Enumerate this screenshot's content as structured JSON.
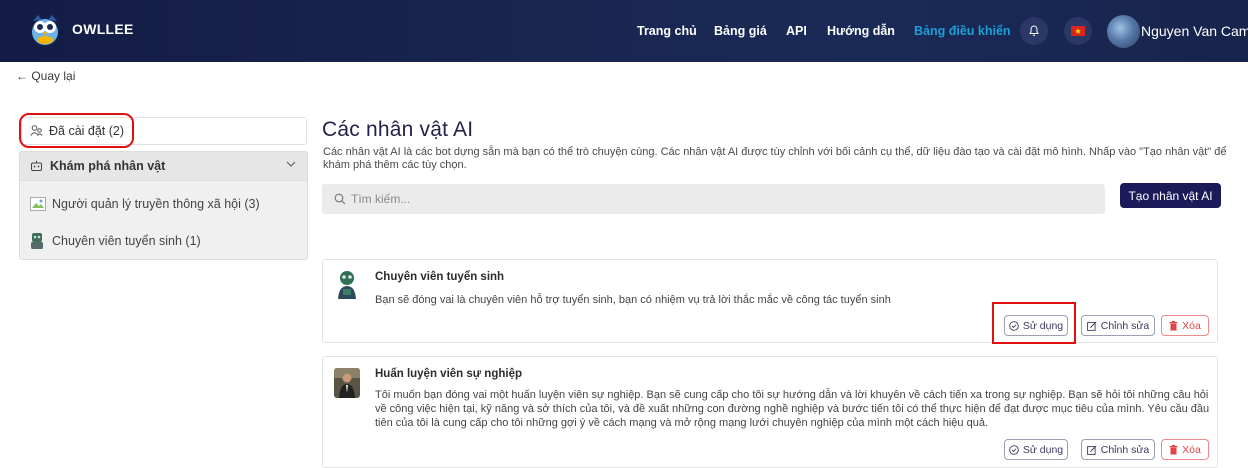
{
  "brand": {
    "name": "OWLLEE"
  },
  "nav": {
    "home": "Trang chủ",
    "pricing": "Bảng giá",
    "api": "API",
    "guide": "Hướng dẫn",
    "dashboard": "Bảng điều khiển",
    "user_name": "Nguyen Van Cam"
  },
  "back_link": "← Quay lại",
  "sidebar": {
    "installed_label": "Đã cài đặt (2)",
    "explore_header": "Khám phá nhân vật",
    "items": [
      {
        "label": "Người quản lý truyền thông xã hội (3)",
        "icon": "broken-image-icon"
      },
      {
        "label": "Chuyên viên tuyển sinh (1)",
        "icon": "robot-avatar-icon"
      }
    ]
  },
  "main": {
    "title": "Các nhân vật AI",
    "description": "Các nhân vật AI là các bot dựng sẵn mà bạn có thể trò chuyện cùng. Các nhân vật AI được tùy chỉnh với bối cảnh cụ thể, dữ liệu đào tạo và cài đặt mô hình. Nhấp vào \"Tạo nhân vật\" để khám phá thêm các tùy chọn.",
    "search_placeholder": "Tìm kiếm...",
    "create_button": "Tạo nhân vật AI"
  },
  "cards": [
    {
      "title": "Chuyên viên tuyển sinh",
      "description": "Bạn sẽ đóng vai là chuyên viên hỗ trợ tuyển sinh, bạn có nhiệm vụ trả lời thắc mắc về công tác tuyển sinh",
      "use_label": "Sử dụng",
      "edit_label": "Chỉnh sửa",
      "delete_label": "Xóa"
    },
    {
      "title": "Huấn luyện viên sự nghiệp",
      "description": "Tôi muốn bạn đóng vai một huấn luyện viên sự nghiệp. Bạn sẽ cung cấp cho tôi sự hướng dẫn và lời khuyên về cách tiến xa trong sự nghiệp. Bạn sẽ hỏi tôi những câu hỏi về công việc hiện tại, kỹ năng và sở thích của tôi, và đề xuất những con đường nghề nghiệp và bước tiến tôi có thể thực hiện để đạt được mục tiêu của mình. Yêu cầu đầu tiên của tôi là cung cấp cho tôi những gợi ý về cách mạng và mở rộng mạng lưới chuyên nghiệp của mình một cách hiệu quả.",
      "use_label": "Sử dụng",
      "edit_label": "Chỉnh sửa",
      "delete_label": "Xóa"
    }
  ],
  "colors": {
    "nav_bg": "#17244d",
    "dashboard_link": "#1d9fd8",
    "primary_button": "#1d1a5a",
    "delete": "#e04444",
    "highlight": "#e01010"
  }
}
